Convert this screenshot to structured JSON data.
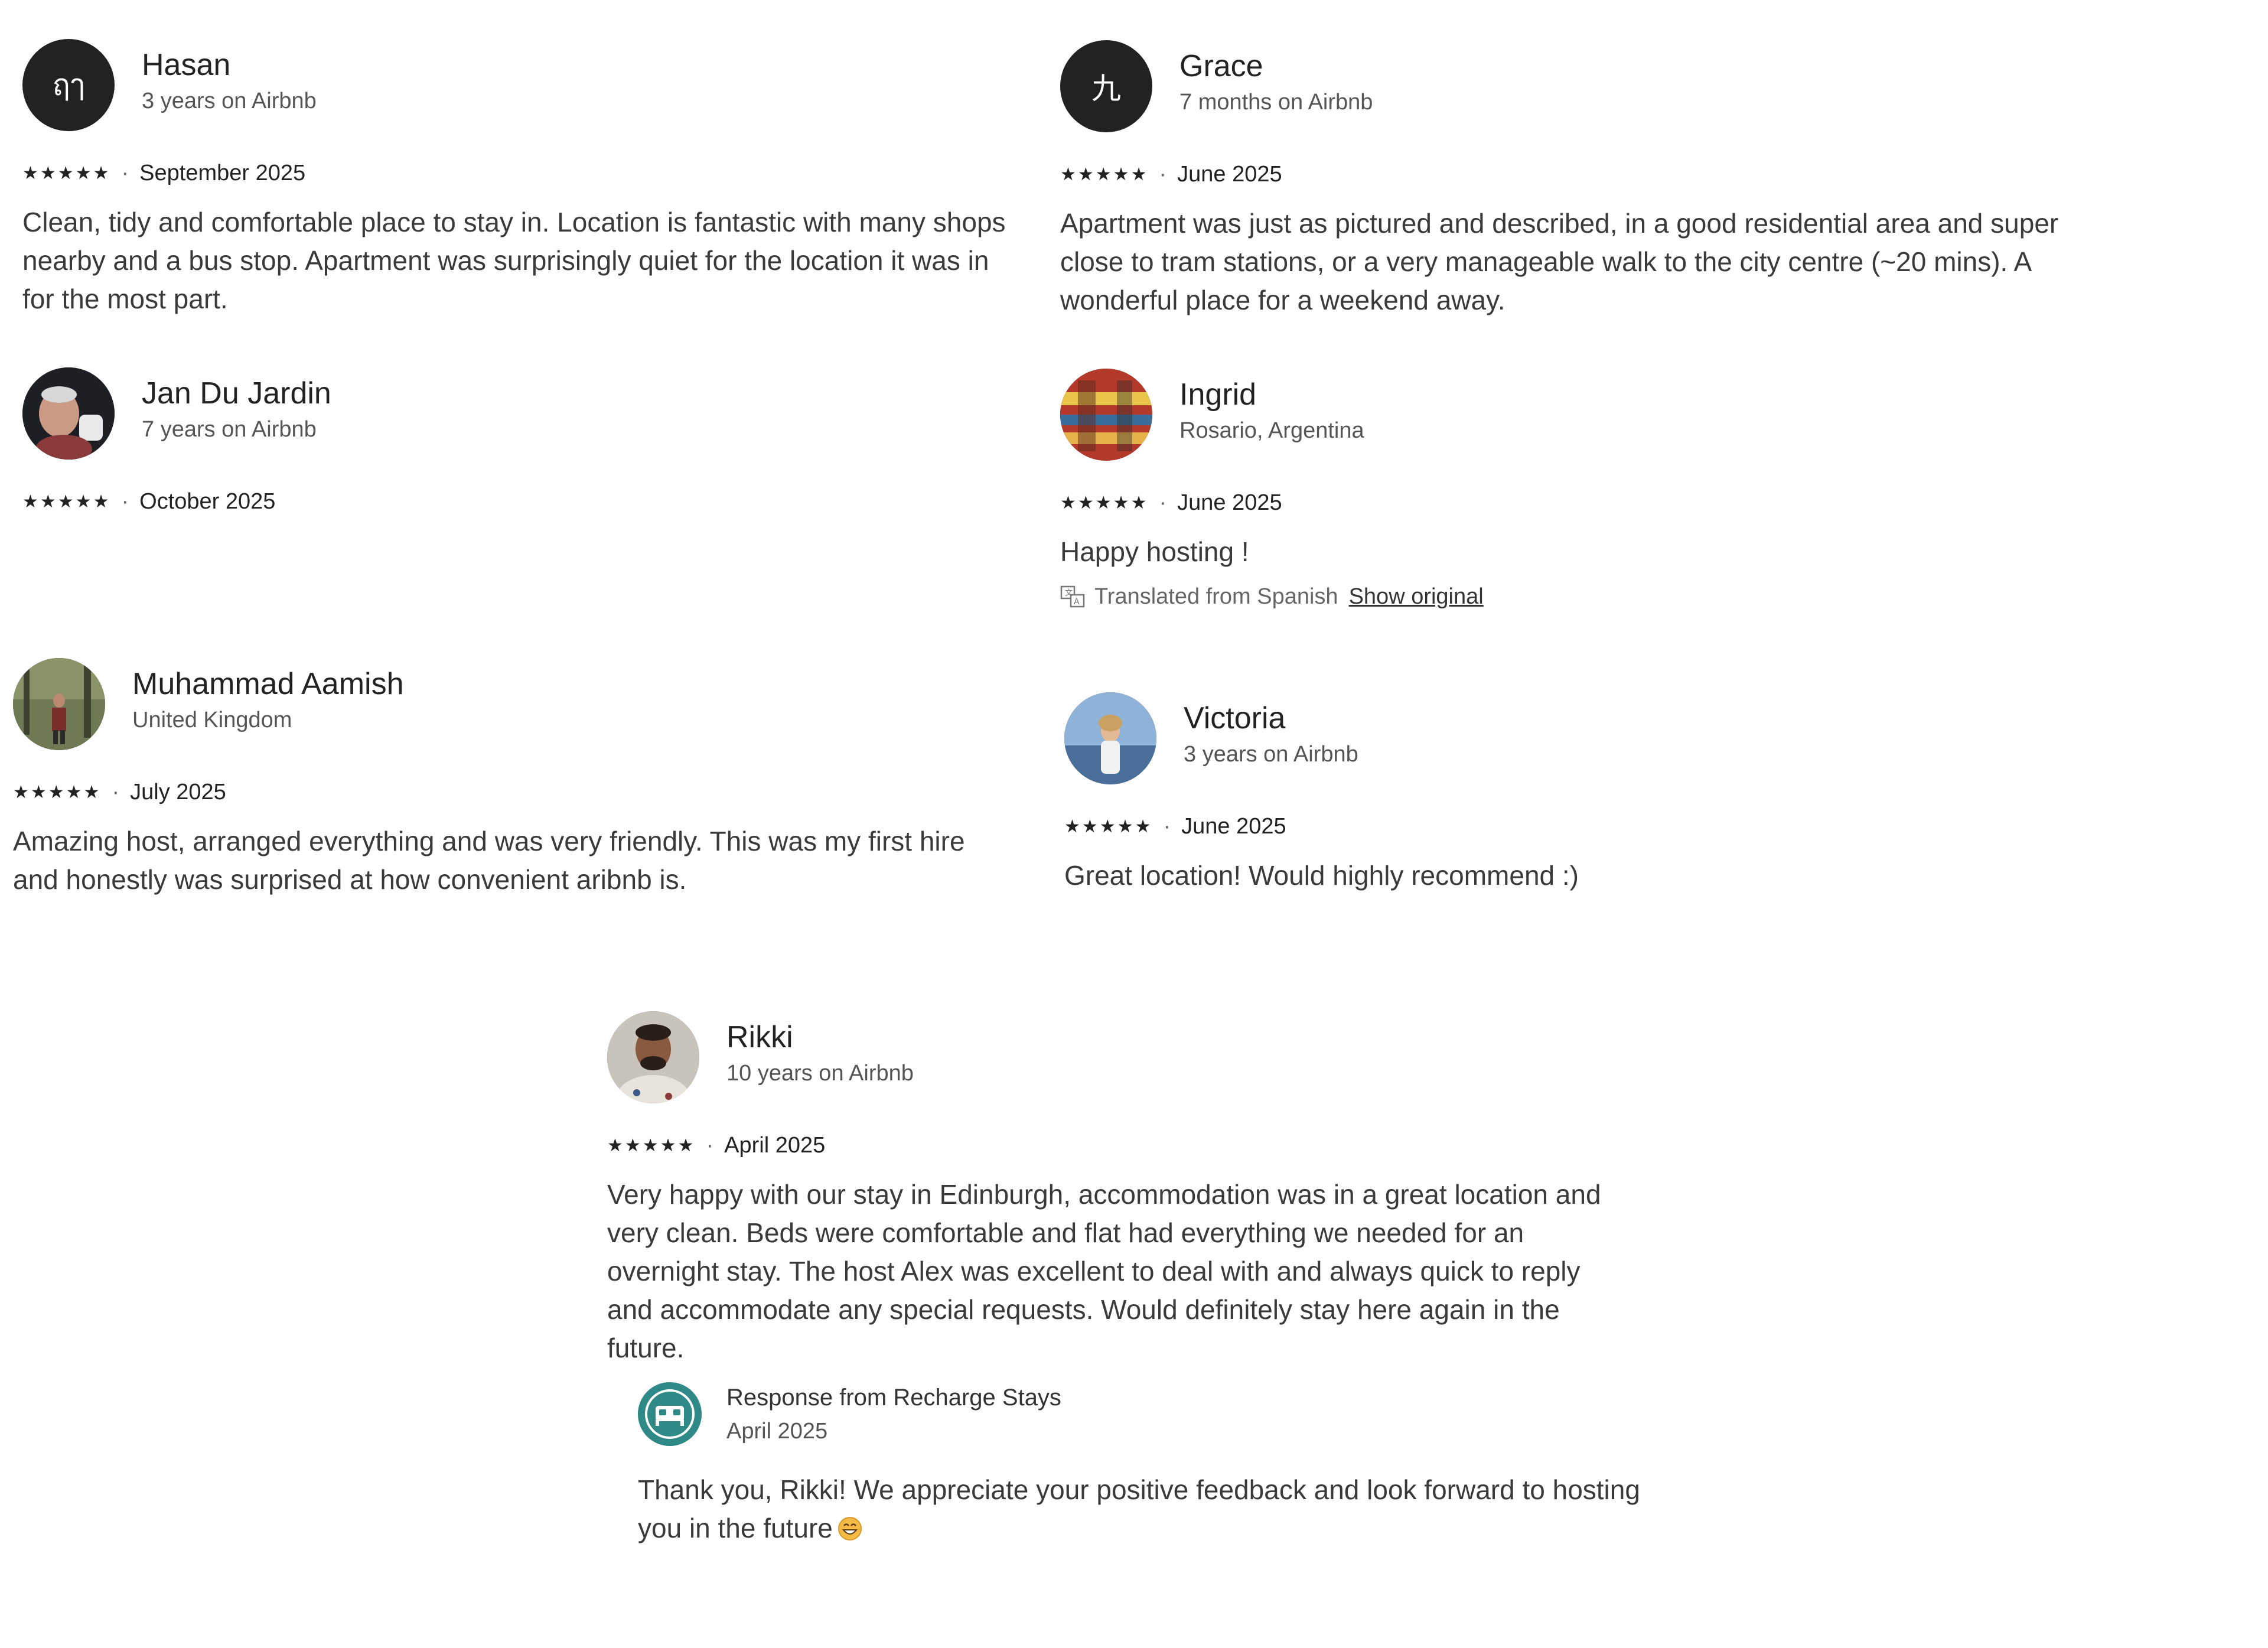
{
  "reviews": [
    {
      "name": "Hasan",
      "meta": "3 years on Airbnb",
      "avatar_initial": "ฤๅ",
      "stars": "★★★★★",
      "date": "September 2025",
      "text": "Clean, tidy and comfortable place to stay in. Location is fantastic with many shops nearby and a bus stop. Apartment was surprisingly quiet for the location it was in for the most part."
    },
    {
      "name": "Grace",
      "meta": "7 months on Airbnb",
      "avatar_initial": "九",
      "stars": "★★★★★",
      "date": "June 2025",
      "text": "Apartment was just as pictured and described, in a good residential area and super close to tram stations, or a very manageable walk to the city centre (~20 mins). A wonderful place for a weekend away."
    },
    {
      "name": "Jan Du Jardin",
      "meta": "7 years on Airbnb",
      "stars": "★★★★★",
      "date": "October 2025",
      "text": ""
    },
    {
      "name": "Ingrid",
      "meta": "Rosario, Argentina",
      "stars": "★★★★★",
      "date": "June 2025",
      "text": "Happy hosting !",
      "translation": {
        "note": "Translated from Spanish",
        "link": "Show original"
      }
    },
    {
      "name": "Muhammad Aamish",
      "meta": "United Kingdom",
      "stars": "★★★★★",
      "date": "July 2025",
      "text": "Amazing host, arranged everything and was very friendly. This was my first hire and honestly was surprised at how convenient aribnb is."
    },
    {
      "name": "Victoria",
      "meta": "3 years on Airbnb",
      "stars": "★★★★★",
      "date": "June 2025",
      "text": "Great location! Would highly recommend :)"
    },
    {
      "name": "Rikki",
      "meta": "10 years on Airbnb",
      "stars": "★★★★★",
      "date": "April 2025",
      "text": "Very happy with our stay in Edinburgh, accommodation was in a great location and very clean. Beds were comfortable and flat had everything we needed for an overnight stay. The host Alex was excellent to deal with and always quick to reply and accommodate any special requests. Would definitely stay here again in the future."
    }
  ],
  "response": {
    "title": "Response from Recharge Stays",
    "date": "April 2025",
    "text": "Thank you, Rikki! We appreciate your positive feedback and look forward to hosting you in the future",
    "icon": "bed-icon",
    "emoji": "grinning-emoji-icon"
  },
  "icons": {
    "translate": "translate-icon"
  },
  "colors": {
    "avatar_bg": "#222222",
    "host_avatar_bg": "#2f8a87",
    "text": "#222222",
    "muted": "#555555"
  }
}
